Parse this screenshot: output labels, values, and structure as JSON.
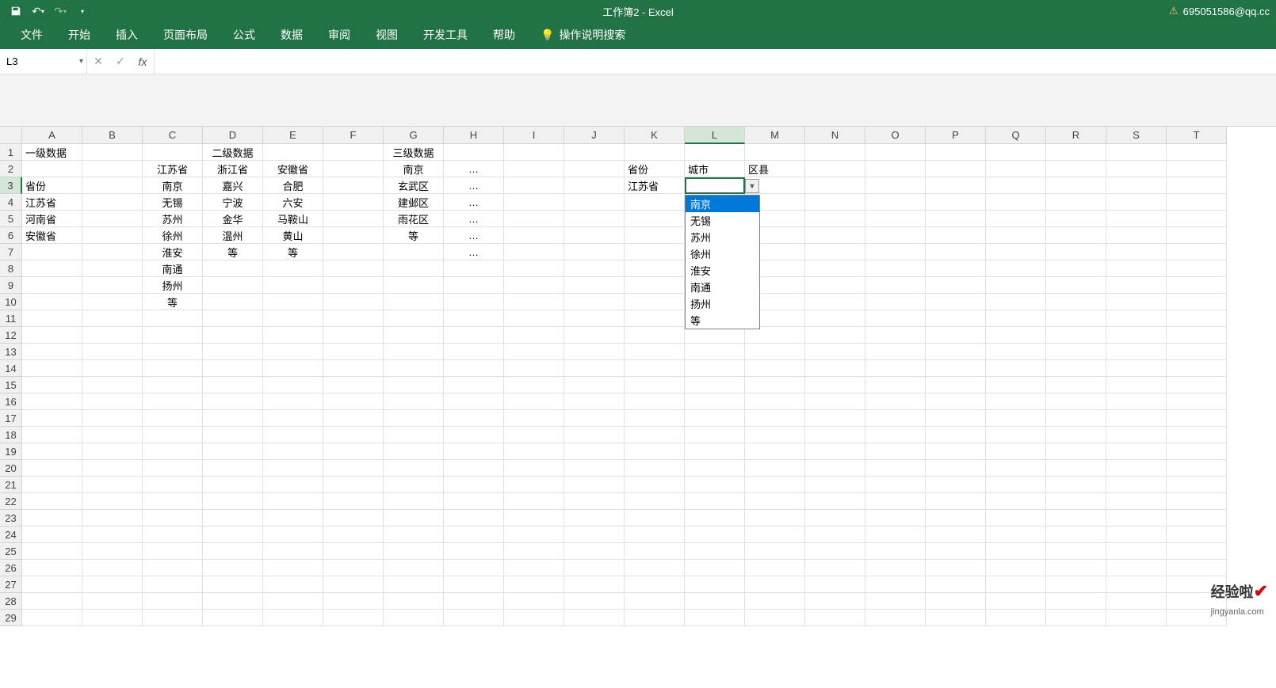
{
  "title": {
    "doc": "工作簿2",
    "sep": "  -  ",
    "app": "Excel"
  },
  "user": {
    "email": "695051586@qq.cc"
  },
  "ribbon": {
    "tabs": [
      "文件",
      "开始",
      "插入",
      "页面布局",
      "公式",
      "数据",
      "审阅",
      "视图",
      "开发工具",
      "帮助"
    ],
    "tellme": "操作说明搜索"
  },
  "namebox": {
    "value": "L3"
  },
  "columns": [
    "A",
    "B",
    "C",
    "D",
    "E",
    "F",
    "G",
    "H",
    "I",
    "J",
    "K",
    "L",
    "M",
    "N",
    "O",
    "P",
    "Q",
    "R",
    "S",
    "T"
  ],
  "rowcount": 29,
  "activeCell": {
    "row": 3,
    "col": "L"
  },
  "cells": {
    "A1": {
      "v": "一级数据",
      "align": "left"
    },
    "D1": {
      "v": "二级数据",
      "align": "center"
    },
    "G1": {
      "v": "三级数据",
      "align": "center"
    },
    "C2": {
      "v": "江苏省",
      "align": "center"
    },
    "D2": {
      "v": "浙江省",
      "align": "center"
    },
    "E2": {
      "v": "安徽省",
      "align": "center"
    },
    "G2": {
      "v": "南京",
      "align": "center"
    },
    "H2": {
      "v": "…",
      "align": "center"
    },
    "K2": {
      "v": "省份",
      "align": "left"
    },
    "L2": {
      "v": "城市",
      "align": "left"
    },
    "M2": {
      "v": "区县",
      "align": "left"
    },
    "A3": {
      "v": "省份",
      "align": "left"
    },
    "C3": {
      "v": "南京",
      "align": "center"
    },
    "D3": {
      "v": "嘉兴",
      "align": "center"
    },
    "E3": {
      "v": "合肥",
      "align": "center"
    },
    "G3": {
      "v": "玄武区",
      "align": "center"
    },
    "H3": {
      "v": "…",
      "align": "center"
    },
    "K3": {
      "v": "江苏省",
      "align": "left"
    },
    "A4": {
      "v": "江苏省",
      "align": "left"
    },
    "C4": {
      "v": "无锡",
      "align": "center"
    },
    "D4": {
      "v": "宁波",
      "align": "center"
    },
    "E4": {
      "v": "六安",
      "align": "center"
    },
    "G4": {
      "v": "建邺区",
      "align": "center"
    },
    "H4": {
      "v": "…",
      "align": "center"
    },
    "A5": {
      "v": "河南省",
      "align": "left"
    },
    "C5": {
      "v": "苏州",
      "align": "center"
    },
    "D5": {
      "v": "金华",
      "align": "center"
    },
    "E5": {
      "v": "马鞍山",
      "align": "center"
    },
    "G5": {
      "v": "雨花区",
      "align": "center"
    },
    "H5": {
      "v": "…",
      "align": "center"
    },
    "A6": {
      "v": "安徽省",
      "align": "left"
    },
    "C6": {
      "v": "徐州",
      "align": "center"
    },
    "D6": {
      "v": "温州",
      "align": "center"
    },
    "E6": {
      "v": "黄山",
      "align": "center"
    },
    "G6": {
      "v": "等",
      "align": "center"
    },
    "H6": {
      "v": "…",
      "align": "center"
    },
    "C7": {
      "v": "淮安",
      "align": "center"
    },
    "D7": {
      "v": "等",
      "align": "center"
    },
    "E7": {
      "v": "等",
      "align": "center"
    },
    "H7": {
      "v": "…",
      "align": "center"
    },
    "C8": {
      "v": "南通",
      "align": "center"
    },
    "C9": {
      "v": "扬州",
      "align": "center"
    },
    "C10": {
      "v": "等",
      "align": "center"
    }
  },
  "dropdown": {
    "items": [
      "南京",
      "无锡",
      "苏州",
      "徐州",
      "淮安",
      "南通",
      "扬州",
      "等"
    ],
    "selectedIndex": 0
  },
  "watermark": {
    "main": "经验啦",
    "sub": "jingyanla.com"
  }
}
